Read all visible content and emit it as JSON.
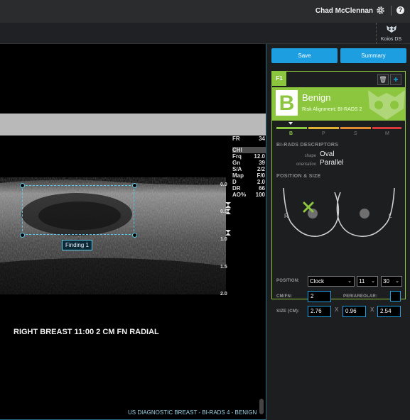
{
  "header": {
    "user_name": "Chad McClennan",
    "help_glyph": "?",
    "icons": [
      "gear-icon",
      "help-icon"
    ]
  },
  "toolbar": {
    "koios_label": "Koios DS",
    "koios_icon": "koios-owl-icon"
  },
  "viewer": {
    "params": [
      {
        "k": "FR",
        "v": "34"
      },
      {
        "k": "CHI",
        "v": ""
      },
      {
        "k": "Frq",
        "v": "12.0"
      },
      {
        "k": "Gn",
        "v": "39"
      },
      {
        "k": "S/A",
        "v": "2/2"
      },
      {
        "k": "Map",
        "v": "F/0"
      },
      {
        "k": "D",
        "v": "2.0"
      },
      {
        "k": "DR",
        "v": "66"
      },
      {
        "k": "AO%",
        "v": "100"
      }
    ],
    "depth_ticks": [
      "0.0",
      "0.5",
      "1.0",
      "1.5",
      "2.0"
    ],
    "finding_label": "Finding 1",
    "caption": "RIGHT BREAST 11:00  2 CM FN RADIAL",
    "footer": "US DIAGNOSTIC BREAST - BI-RADS 4 - BENIGN"
  },
  "actions": {
    "save_label": "Save",
    "summary_label": "Summary"
  },
  "finding_card": {
    "tab_label": "F1",
    "trash_glyph": "🗑",
    "add_glyph": "+",
    "verdict_letter": "B",
    "verdict_title": "Benign",
    "verdict_subtitle": "Risk Alignment: BI-RADS 2",
    "accent_color": "#8cc63f",
    "risk_scale": {
      "labels": [
        "B",
        "P",
        "S",
        "M"
      ],
      "colors": [
        "#8cc63f",
        "#e0b132",
        "#e08a32",
        "#d9393b"
      ],
      "selected": "B"
    },
    "descriptors_title": "BI-RADS DESCRIPTORS",
    "descriptors": [
      {
        "key": "shape",
        "value": "Oval"
      },
      {
        "key": "orientation",
        "value": "Parallel"
      }
    ],
    "position_title": "POSITION & SIZE",
    "breast_labels": {
      "right": "R",
      "left": "L"
    },
    "position": {
      "label": "POSITION:",
      "mode": "Clock",
      "hour": "11",
      "minute": "30"
    },
    "cmfn": {
      "label": "CM/FN:",
      "value": "2"
    },
    "periareolar": {
      "label": "PERIAREOLAR:",
      "checked": false
    },
    "size": {
      "label": "SIZE (CM):",
      "values": [
        "2.76",
        "0.96",
        "2.54"
      ],
      "separator": "X"
    }
  }
}
